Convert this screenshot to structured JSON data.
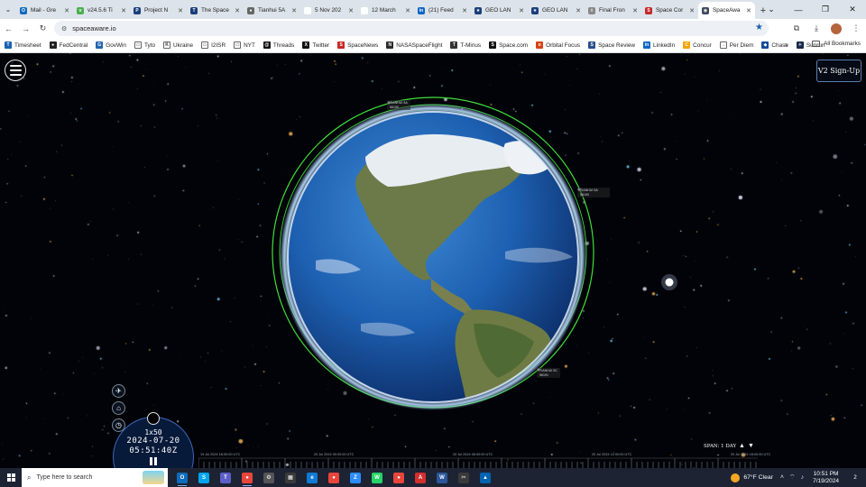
{
  "browser": {
    "tabs": [
      {
        "title": "Mail - Gre",
        "fav_color": "#0f6cbd",
        "fav_glyph": "O"
      },
      {
        "title": "v24.5.6 Ti",
        "fav_color": "#4caf50",
        "fav_glyph": "v"
      },
      {
        "title": "Project N",
        "fav_color": "#1a3d7c",
        "fav_glyph": "P"
      },
      {
        "title": "The Space",
        "fav_color": "#1a3d7c",
        "fav_glyph": "T"
      },
      {
        "title": "Tianhui 5A",
        "fav_color": "#666666",
        "fav_glyph": "●"
      },
      {
        "title": "5 Nov 202",
        "fav_color": "#ffffff",
        "fav_glyph": ""
      },
      {
        "title": "12 March",
        "fav_color": "#ffffff",
        "fav_glyph": ""
      },
      {
        "title": "(21) Feed",
        "fav_color": "#0a66c2",
        "fav_glyph": "in"
      },
      {
        "title": "GEO LAN",
        "fav_color": "#1a3d7c",
        "fav_glyph": "★"
      },
      {
        "title": "GEO LAN",
        "fav_color": "#1a3d7c",
        "fav_glyph": "★"
      },
      {
        "title": "Final Fron",
        "fav_color": "#888888",
        "fav_glyph": "◊"
      },
      {
        "title": "Space Cor",
        "fav_color": "#c62828",
        "fav_glyph": "S"
      },
      {
        "title": "SpaceAwa",
        "fav_color": "#3c4a5c",
        "fav_glyph": "◉",
        "active": true
      }
    ],
    "url": "spaceaware.io",
    "window_controls": [
      "⌄",
      "—",
      "❐",
      "✕"
    ],
    "bookmarks": [
      {
        "label": "Timesheet",
        "color": "#1a5fb4",
        "glyph": "T"
      },
      {
        "label": "FedCentral",
        "color": "#222222",
        "glyph": "●"
      },
      {
        "label": "GovWin",
        "color": "#2466b0",
        "glyph": "G"
      },
      {
        "label": "Tyto",
        "color": "#ffffff",
        "glyph": "▭"
      },
      {
        "label": "Ukraine",
        "color": "#ffffff",
        "glyph": "K"
      },
      {
        "label": "I2ISR",
        "color": "#ffffff",
        "glyph": "▭"
      },
      {
        "label": "NYT",
        "color": "#ffffff",
        "glyph": "▭"
      },
      {
        "label": "Threads",
        "color": "#111111",
        "glyph": "@"
      },
      {
        "label": "Twitter",
        "color": "#111111",
        "glyph": "X"
      },
      {
        "label": "SpaceNews",
        "color": "#c62828",
        "glyph": "S"
      },
      {
        "label": "NASASpaceFlight",
        "color": "#2a2a2a",
        "glyph": "N"
      },
      {
        "label": "T-Minus",
        "color": "#333333",
        "glyph": "T"
      },
      {
        "label": "Space.com",
        "color": "#111111",
        "glyph": "S"
      },
      {
        "label": "Orbital Focus",
        "color": "#d84315",
        "glyph": "o"
      },
      {
        "label": "Space Review",
        "color": "#2b4d8c",
        "glyph": "S"
      },
      {
        "label": "LinkedIn",
        "color": "#0a66c2",
        "glyph": "in"
      },
      {
        "label": "Concur",
        "color": "#f0a500",
        "glyph": "C"
      },
      {
        "label": "Per Diem",
        "color": "#ffffff",
        "glyph": "→"
      },
      {
        "label": "Chase",
        "color": "#124a9a",
        "glyph": "◆"
      },
      {
        "label": "Sunrun",
        "color": "#1b2a4a",
        "glyph": "☀"
      }
    ],
    "bookmarks_more": "»",
    "all_bookmarks": "All Bookmarks"
  },
  "app": {
    "signup_label": "V2 Sign-Up",
    "satellites": [
      {
        "name": "TIANHUI 5A",
        "id": "56190"
      },
      {
        "name": "TIANHUI 5A",
        "id": "56190"
      },
      {
        "name": "TIANHUI 5C",
        "id": "56191"
      }
    ],
    "clock": {
      "speed": "1x50",
      "date": "2024-07-20",
      "time": "05:51:40Z"
    },
    "timeline": {
      "labels": [
        "19 Jul 2024 18:00:00 UTC",
        "20 Jul 2024 00:00:00 UTC",
        "20 Jul 2024 06:00:00 UTC",
        "20 Jul 2024 12:00:00 UTC",
        "20 Jul 2024 18:00:00 UTC"
      ],
      "span_label": "SPAN: 1 DAY"
    },
    "colors": {
      "orbit": "#3fe03a",
      "clock_bg": "#081a3a",
      "ocean": "#1d5fb0"
    }
  },
  "taskbar": {
    "search_placeholder": "Type here to search",
    "apps": [
      {
        "name": "outlook",
        "color": "#0f6cbd",
        "glyph": "O",
        "run": true
      },
      {
        "name": "skype",
        "color": "#00a4ef",
        "glyph": "S",
        "run": false
      },
      {
        "name": "teams",
        "color": "#5b5fc7",
        "glyph": "T",
        "run": false
      },
      {
        "name": "chrome",
        "color": "#e8453c",
        "glyph": "●",
        "run": true
      },
      {
        "name": "settings",
        "color": "#555555",
        "glyph": "⚙",
        "run": false
      },
      {
        "name": "calculator",
        "color": "#3a3a3a",
        "glyph": "▦",
        "run": false
      },
      {
        "name": "edge",
        "color": "#0f7bd4",
        "glyph": "e",
        "run": false
      },
      {
        "name": "chrome-2",
        "color": "#e8453c",
        "glyph": "●",
        "run": false
      },
      {
        "name": "zoom",
        "color": "#2d8cff",
        "glyph": "Z",
        "run": false
      },
      {
        "name": "whatsapp",
        "color": "#25d366",
        "glyph": "W",
        "run": false
      },
      {
        "name": "chrome-3",
        "color": "#e8453c",
        "glyph": "●",
        "run": false
      },
      {
        "name": "acrobat",
        "color": "#d32f2f",
        "glyph": "A",
        "run": false
      },
      {
        "name": "word",
        "color": "#2b579a",
        "glyph": "W",
        "run": false
      },
      {
        "name": "capture",
        "color": "#3a3a3a",
        "glyph": "✂",
        "run": false
      },
      {
        "name": "photos",
        "color": "#0063b1",
        "glyph": "▲",
        "run": false
      }
    ],
    "weather": "67°F  Clear",
    "time": "10:51 PM",
    "date": "7/19/2024",
    "notif_count": "2"
  }
}
